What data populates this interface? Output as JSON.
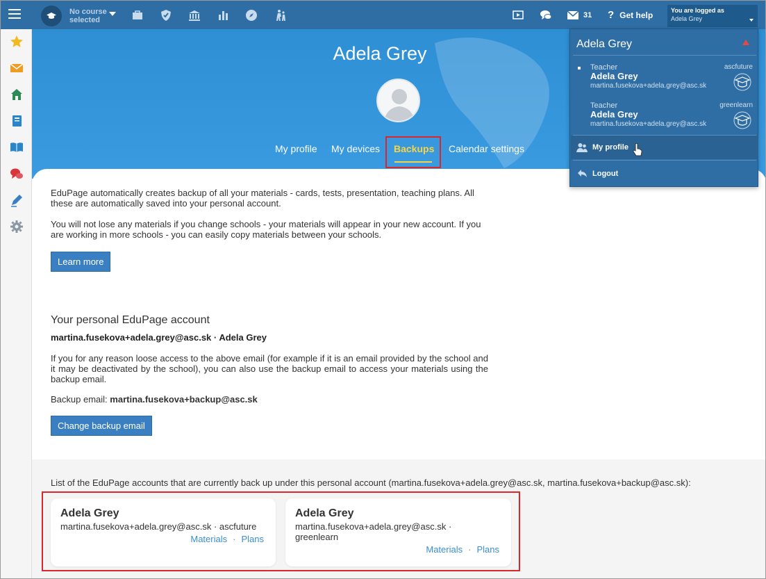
{
  "topbar": {
    "course_label": "No course selected",
    "messages_count": "31",
    "get_help": "Get help",
    "logged_in_label": "You are logged as",
    "logged_in_user": "Adela Grey"
  },
  "hero": {
    "name": "Adela Grey",
    "tabs": [
      {
        "label": "My profile",
        "active": false
      },
      {
        "label": "My devices",
        "active": false
      },
      {
        "label": "Backups",
        "active": true
      },
      {
        "label": "Calendar settings",
        "active": false
      }
    ]
  },
  "main": {
    "intro_1": "EduPage automatically creates backup of all your materials - cards, tests, presentation, teaching plans. All these are automatically saved into your personal account.",
    "intro_2": "You will not lose any materials if you change schools - your materials will appear in your new account. If you are working in more schools - you can easily copy materials between your schools.",
    "learn_more": "Learn more",
    "account_heading": "Your personal EduPage account",
    "account_line": "martina.fusekova+adela.grey@asc.sk · Adela Grey",
    "backup_explain": "If you for any reason loose access to the above email (for example if it is an email provided by the school and it may be deactivated by the school), you can also use the backup email to access your materials using the backup email.",
    "backup_email_label": "Backup email:",
    "backup_email": "martina.fusekova+backup@asc.sk",
    "change_backup": "Change backup email"
  },
  "accounts_list": {
    "intro": "List of the EduPage accounts that are currently back up under this personal account (martina.fusekova+adela.grey@asc.sk, martina.fusekova+backup@asc.sk):",
    "cards": [
      {
        "name": "Adela Grey",
        "email_school": "martina.fusekova+adela.grey@asc.sk · ascfuture",
        "materials": "Materials",
        "plans": "Plans"
      },
      {
        "name": "Adela Grey",
        "email_school": "martina.fusekova+adela.grey@asc.sk · greenlearn",
        "materials": "Materials",
        "plans": "Plans"
      }
    ]
  },
  "dropdown": {
    "title": "Adela Grey",
    "accounts": [
      {
        "role": "Teacher",
        "name": "Adela Grey",
        "email": "martina.fusekova+adela.grey@asc.sk",
        "school": "ascfuture"
      },
      {
        "role": "Teacher",
        "name": "Adela Grey",
        "email": "martina.fusekova+adela.grey@asc.sk",
        "school": "greenlearn"
      }
    ],
    "my_profile": "My profile",
    "logout": "Logout"
  },
  "colors": {
    "topbar": "#2f6ea5",
    "hero": "#3a9be0",
    "active_tab": "#f7d34a",
    "button": "#3a7fc1",
    "link": "#3a8ed1",
    "highlight": "#d9272e"
  },
  "icons": {
    "sidebar": [
      "star-icon",
      "envelope-icon",
      "home-icon",
      "notebook-icon",
      "open-book-icon",
      "chat-bubbles-icon",
      "pen-icon",
      "gear-icon"
    ],
    "topbar": [
      "briefcase-icon",
      "shield-icon",
      "school-building-icon",
      "bar-chart-icon",
      "compass-icon",
      "students-icon",
      "cast-icon",
      "chat-icon",
      "mail-icon",
      "help-icon"
    ]
  }
}
